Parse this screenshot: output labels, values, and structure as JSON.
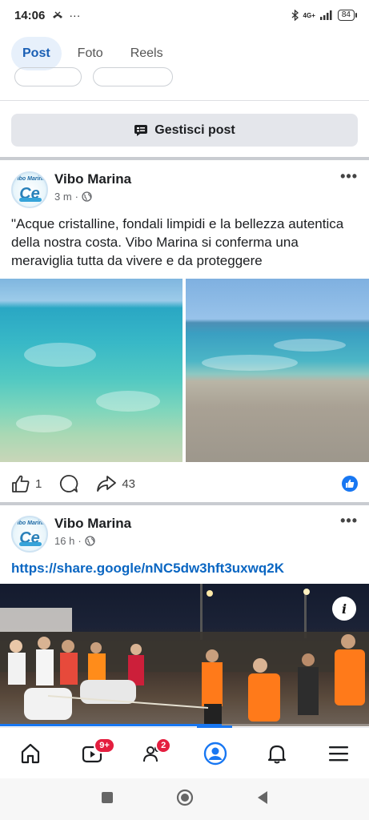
{
  "status_bar": {
    "time": "14:06",
    "extra_icons": "···",
    "network": "4G+",
    "battery": "84"
  },
  "tabs": [
    {
      "label": "Post",
      "active": true
    },
    {
      "label": "Foto",
      "active": false
    },
    {
      "label": "Reels",
      "active": false
    }
  ],
  "manage_button": {
    "label": "Gestisci post",
    "icon": "manage-posts-icon"
  },
  "post1": {
    "page_name": "Vibo Marina",
    "time": "3 m",
    "privacy_icon": "globe-icon",
    "text": "\"Acque cristalline, fondali limpidi e la bellezza autentica della nostra costa. Vibo Marina si conferma una meraviglia tutta da vivere e da proteggere",
    "likes": "1",
    "shares": "43",
    "avatar_text": "Vibo Marina",
    "avatar_letter": "Ce"
  },
  "post2": {
    "page_name": "Vibo Marina",
    "time": "16 h",
    "privacy_icon": "globe-icon",
    "link": "https://share.google/nNC5dw3hft3uxwq2K",
    "avatar_text": "Vibo Marina",
    "avatar_letter": "Ce",
    "video_progress": 0.6
  },
  "bottom_nav": {
    "items": [
      "home-icon",
      "video-icon",
      "friends-icon",
      "profile-icon",
      "notifications-icon",
      "menu-icon"
    ],
    "video_badge": "9+",
    "friends_badge": "2",
    "active": "profile-icon"
  },
  "colors": {
    "accent": "#1877f2",
    "link": "#0a66c2",
    "badge": "#e41e3f",
    "active_tab_bg": "#e7f0fb"
  }
}
